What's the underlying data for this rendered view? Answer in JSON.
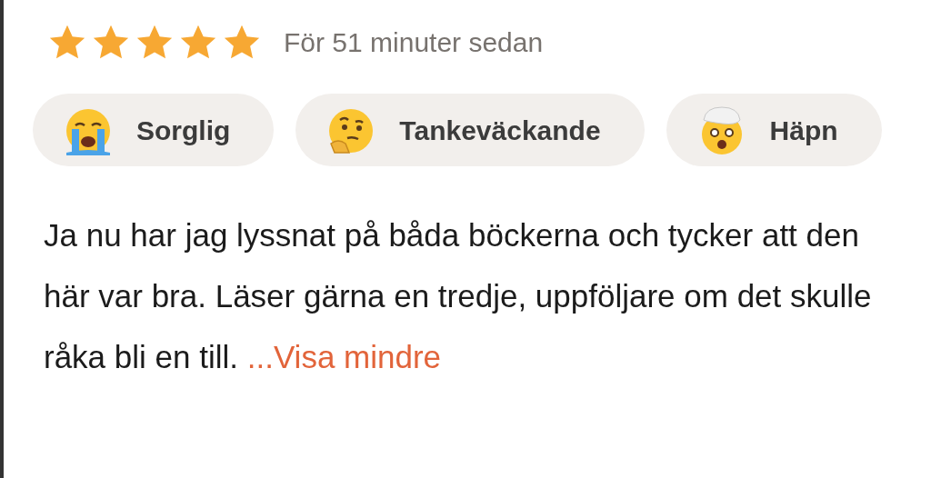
{
  "review": {
    "stars": 5,
    "time": "För 51 minuter sedan"
  },
  "reactions": [
    {
      "kind": "crying",
      "label": "Sorglig"
    },
    {
      "kind": "thinking",
      "label": "Tankeväckande"
    },
    {
      "kind": "exploding",
      "label": "Häpn"
    }
  ],
  "text": "Ja nu har jag lyssnat på båda böckerna och tycker att den här var bra. Läser gärna en tredje, uppföljare om det skulle råka bli en till.",
  "toggle_link": "...Visa mindre"
}
